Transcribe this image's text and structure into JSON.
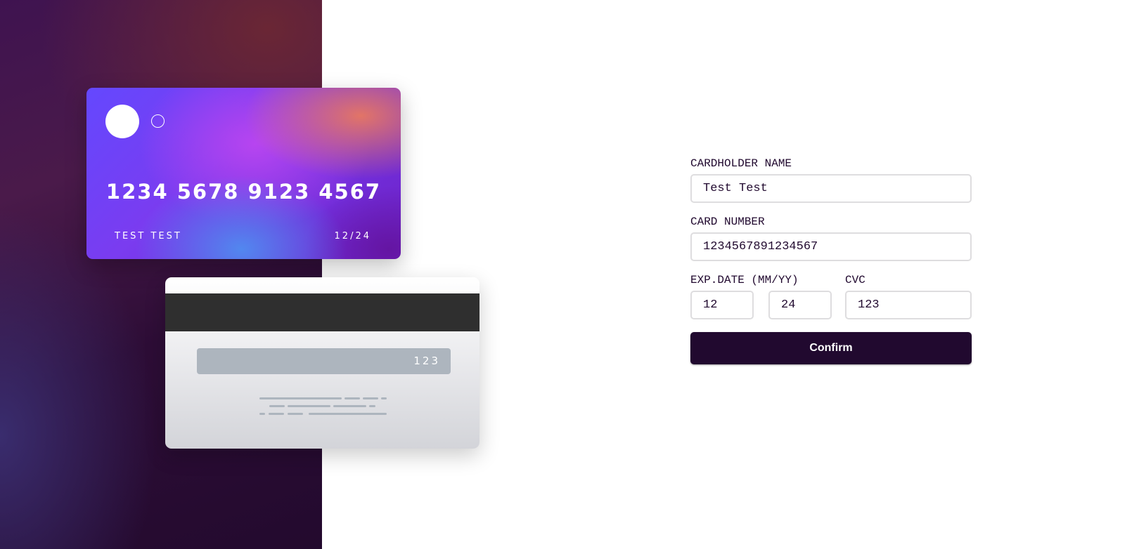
{
  "card_front": {
    "number": "1234 5678 9123 4567",
    "name": "TEST TEST",
    "expiry": "12/24"
  },
  "card_back": {
    "cvc": "123"
  },
  "form": {
    "cardholder_label": "CARDHOLDER NAME",
    "cardholder_value": "Test Test",
    "number_label": "CARD NUMBER",
    "number_value": "1234567891234567",
    "exp_label": "EXP.DATE (MM/YY)",
    "exp_month_value": "12",
    "exp_year_value": "24",
    "cvc_label": "CVC",
    "cvc_value": "123",
    "confirm_label": "Confirm"
  },
  "colors": {
    "dark_violet": "#21092f",
    "input_border": "#dedddf",
    "strip_gray": "#adb5be"
  }
}
